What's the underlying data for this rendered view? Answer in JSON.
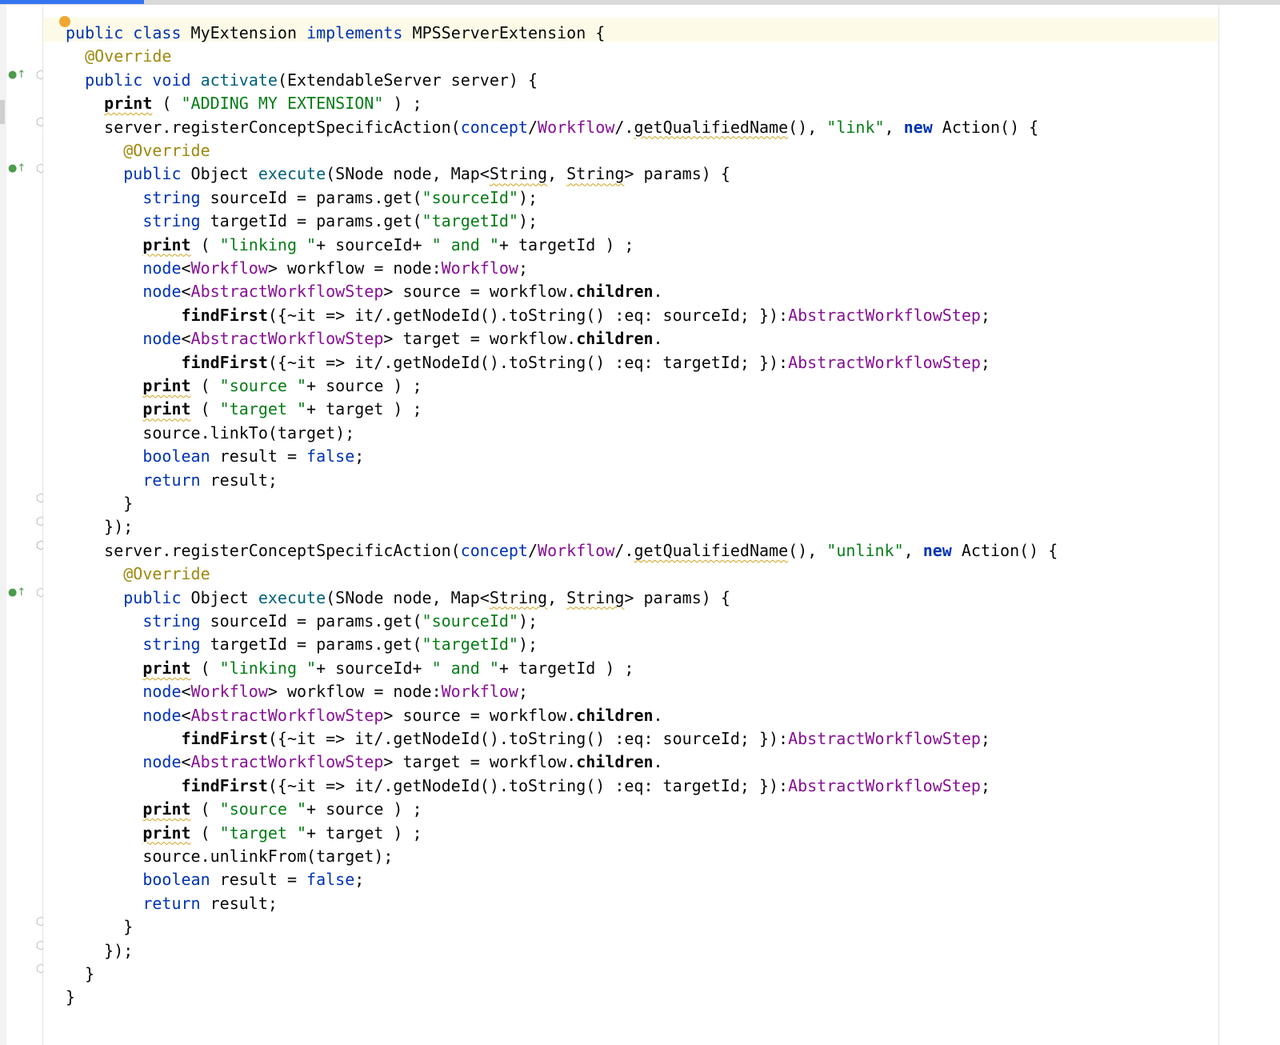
{
  "editor": {
    "accent_color": "#3574f0",
    "colors": {
      "keyword": "#0033b3",
      "string": "#067d17",
      "annotation": "#9e880d",
      "concept": "#871094",
      "method": "#00627a",
      "default": "#080808"
    },
    "gutter_icons": {
      "override": "override-up-arrow-icon",
      "fold_start": "fold-open-icon",
      "fold_end": "fold-close-icon"
    },
    "lines": [
      [
        [
          "public",
          "kw"
        ],
        [
          " "
        ],
        [
          "class",
          "kw"
        ],
        [
          " MyExtension "
        ],
        [
          "implements",
          "kw"
        ],
        [
          " MPSServerExtension {"
        ]
      ],
      [
        [
          "  "
        ],
        [
          "@Override",
          "ann"
        ]
      ],
      [
        [
          "  "
        ],
        [
          "public",
          "kw"
        ],
        [
          " "
        ],
        [
          "void",
          "kw"
        ],
        [
          " "
        ],
        [
          "activate",
          "fn"
        ],
        [
          "(ExtendableServer server) {"
        ]
      ],
      [
        [
          "    "
        ],
        [
          "print",
          "bold squig"
        ],
        [
          " ( "
        ],
        [
          "\"ADDING MY EXTENSION\"",
          "str"
        ],
        [
          " ) ;"
        ]
      ],
      [
        [
          "    server.registerConceptSpecificAction("
        ],
        [
          "concept",
          "kw"
        ],
        [
          "/"
        ],
        [
          "Workflow",
          "con"
        ],
        [
          "/."
        ],
        [
          "getQualifiedName",
          "strike squig"
        ],
        [
          "(), "
        ],
        [
          "\"link\"",
          "str"
        ],
        [
          ", "
        ],
        [
          "new",
          "kwb"
        ],
        [
          " Action() {"
        ]
      ],
      [
        [
          "      "
        ],
        [
          "@Override",
          "ann"
        ]
      ],
      [
        [
          "      "
        ],
        [
          "public",
          "kw"
        ],
        [
          " Object "
        ],
        [
          "execute",
          "fn"
        ],
        [
          "(SNode node, Map<"
        ],
        [
          "String",
          "squig"
        ],
        [
          ", "
        ],
        [
          "String",
          "squig"
        ],
        [
          "> params) {"
        ]
      ],
      [
        [
          "        "
        ],
        [
          "string",
          "kw"
        ],
        [
          " sourceId = params.get("
        ],
        [
          "\"sourceId\"",
          "str"
        ],
        [
          ");"
        ]
      ],
      [
        [
          "        "
        ],
        [
          "string",
          "kw"
        ],
        [
          " targetId = params.get("
        ],
        [
          "\"targetId\"",
          "str"
        ],
        [
          ");"
        ]
      ],
      [
        [
          "        "
        ],
        [
          "print",
          "bold squig"
        ],
        [
          " ( "
        ],
        [
          "\"linking \"",
          "str"
        ],
        [
          "+ sourceId+ "
        ],
        [
          "\" and \"",
          "str"
        ],
        [
          "+ targetId ) ;"
        ]
      ],
      [
        [
          "        "
        ],
        [
          "node",
          "kw"
        ],
        [
          "<"
        ],
        [
          "Workflow",
          "con"
        ],
        [
          "> workflow = node:"
        ],
        [
          "Workflow",
          "con"
        ],
        [
          ";"
        ]
      ],
      [
        [
          "        "
        ],
        [
          "node",
          "kw"
        ],
        [
          "<"
        ],
        [
          "AbstractWorkflowStep",
          "con"
        ],
        [
          "> source = workflow."
        ],
        [
          "children",
          "bold"
        ],
        [
          "."
        ]
      ],
      [
        [
          "            "
        ],
        [
          "findFirst",
          "bold"
        ],
        [
          "({~it => it/.getNodeId().toString() :eq: sourceId; }):"
        ],
        [
          "AbstractWorkflowStep",
          "con"
        ],
        [
          ";"
        ]
      ],
      [
        [
          "        "
        ],
        [
          "node",
          "kw"
        ],
        [
          "<"
        ],
        [
          "AbstractWorkflowStep",
          "con"
        ],
        [
          "> target = workflow."
        ],
        [
          "children",
          "bold"
        ],
        [
          "."
        ]
      ],
      [
        [
          "            "
        ],
        [
          "findFirst",
          "bold"
        ],
        [
          "({~it => it/.getNodeId().toString() :eq: targetId; }):"
        ],
        [
          "AbstractWorkflowStep",
          "con"
        ],
        [
          ";"
        ]
      ],
      [
        [
          "        "
        ],
        [
          "print",
          "bold squig"
        ],
        [
          " ( "
        ],
        [
          "\"source \"",
          "str"
        ],
        [
          "+ source ) ;"
        ]
      ],
      [
        [
          "        "
        ],
        [
          "print",
          "bold squig"
        ],
        [
          " ( "
        ],
        [
          "\"target \"",
          "str"
        ],
        [
          "+ target ) ;"
        ]
      ],
      [
        [
          "        source.linkTo(target);"
        ]
      ],
      [
        [
          "        "
        ],
        [
          "boolean",
          "kw"
        ],
        [
          " result = "
        ],
        [
          "false",
          "kw"
        ],
        [
          ";"
        ]
      ],
      [
        [
          "        "
        ],
        [
          "return",
          "kw"
        ],
        [
          " result;"
        ]
      ],
      [
        [
          "      }"
        ]
      ],
      [
        [
          "    });"
        ]
      ],
      [
        [
          "    server.registerConceptSpecificAction("
        ],
        [
          "concept",
          "kw"
        ],
        [
          "/"
        ],
        [
          "Workflow",
          "con"
        ],
        [
          "/."
        ],
        [
          "getQualifiedName",
          "strike squig"
        ],
        [
          "(), "
        ],
        [
          "\"unlink\"",
          "str"
        ],
        [
          ", "
        ],
        [
          "new",
          "kwb"
        ],
        [
          " Action() {"
        ]
      ],
      [
        [
          "      "
        ],
        [
          "@Override",
          "ann"
        ]
      ],
      [
        [
          "      "
        ],
        [
          "public",
          "kw"
        ],
        [
          " Object "
        ],
        [
          "execute",
          "fn"
        ],
        [
          "(SNode node, Map<"
        ],
        [
          "String",
          "squig"
        ],
        [
          ", "
        ],
        [
          "String",
          "squig"
        ],
        [
          "> params) {"
        ]
      ],
      [
        [
          "        "
        ],
        [
          "string",
          "kw"
        ],
        [
          " sourceId = params.get("
        ],
        [
          "\"sourceId\"",
          "str"
        ],
        [
          ");"
        ]
      ],
      [
        [
          "        "
        ],
        [
          "string",
          "kw"
        ],
        [
          " targetId = params.get("
        ],
        [
          "\"targetId\"",
          "str"
        ],
        [
          ");"
        ]
      ],
      [
        [
          "        "
        ],
        [
          "print",
          "bold squig"
        ],
        [
          " ( "
        ],
        [
          "\"linking \"",
          "str"
        ],
        [
          "+ sourceId+ "
        ],
        [
          "\" and \"",
          "str"
        ],
        [
          "+ targetId ) ;"
        ]
      ],
      [
        [
          "        "
        ],
        [
          "node",
          "kw"
        ],
        [
          "<"
        ],
        [
          "Workflow",
          "con"
        ],
        [
          "> workflow = node:"
        ],
        [
          "Workflow",
          "con"
        ],
        [
          ";"
        ]
      ],
      [
        [
          "        "
        ],
        [
          "node",
          "kw"
        ],
        [
          "<"
        ],
        [
          "AbstractWorkflowStep",
          "con"
        ],
        [
          "> source = workflow."
        ],
        [
          "children",
          "bold"
        ],
        [
          "."
        ]
      ],
      [
        [
          "            "
        ],
        [
          "findFirst",
          "bold"
        ],
        [
          "({~it => it/.getNodeId().toString() :eq: sourceId; }):"
        ],
        [
          "AbstractWorkflowStep",
          "con"
        ],
        [
          ";"
        ]
      ],
      [
        [
          "        "
        ],
        [
          "node",
          "kw"
        ],
        [
          "<"
        ],
        [
          "AbstractWorkflowStep",
          "con"
        ],
        [
          "> target = workflow."
        ],
        [
          "children",
          "bold"
        ],
        [
          "."
        ]
      ],
      [
        [
          "            "
        ],
        [
          "findFirst",
          "bold"
        ],
        [
          "({~it => it/.getNodeId().toString() :eq: targetId; }):"
        ],
        [
          "AbstractWorkflowStep",
          "con"
        ],
        [
          ";"
        ]
      ],
      [
        [
          "        "
        ],
        [
          "print",
          "bold squig"
        ],
        [
          " ( "
        ],
        [
          "\"source \"",
          "str"
        ],
        [
          "+ source ) ;"
        ]
      ],
      [
        [
          "        "
        ],
        [
          "print",
          "bold squig"
        ],
        [
          " ( "
        ],
        [
          "\"target \"",
          "str"
        ],
        [
          "+ target ) ;"
        ]
      ],
      [
        [
          "        source.unlinkFrom(target);"
        ]
      ],
      [
        [
          "        "
        ],
        [
          "boolean",
          "kw"
        ],
        [
          " result = "
        ],
        [
          "false",
          "kw"
        ],
        [
          ";"
        ]
      ],
      [
        [
          "        "
        ],
        [
          "return",
          "kw"
        ],
        [
          " result;"
        ]
      ],
      [
        [
          "      }"
        ]
      ],
      [
        [
          "    });"
        ]
      ],
      [
        [
          "  }"
        ]
      ],
      [
        [
          "}"
        ]
      ]
    ],
    "override_rows": [
      2,
      6,
      24
    ],
    "fold_open_rows": [
      2,
      4,
      6,
      22,
      24
    ],
    "fold_close_rows": [
      20,
      21,
      22,
      38,
      39,
      40
    ]
  }
}
